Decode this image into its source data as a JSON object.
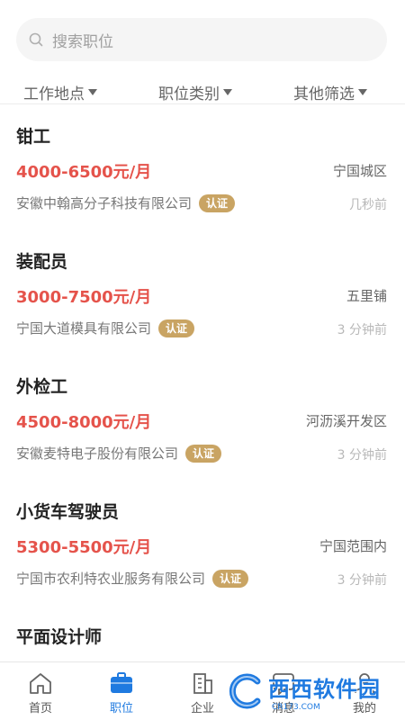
{
  "search": {
    "placeholder": "搜索职位"
  },
  "filters": [
    {
      "label": "工作地点"
    },
    {
      "label": "职位类别"
    },
    {
      "label": "其他筛选"
    }
  ],
  "jobs": [
    {
      "title": "钳工",
      "salary": "4000-6500元/月",
      "location": "宁国城区",
      "company": "安徽中翰高分子科技有限公司",
      "badge": "认证",
      "time": "几秒前"
    },
    {
      "title": "装配员",
      "salary": "3000-7500元/月",
      "location": "五里铺",
      "company": "宁国大道模具有限公司",
      "badge": "认证",
      "time": "3 分钟前"
    },
    {
      "title": "外检工",
      "salary": "4500-8000元/月",
      "location": "河沥溪开发区",
      "company": "安徽麦特电子股份有限公司",
      "badge": "认证",
      "time": "3 分钟前"
    },
    {
      "title": "小货车驾驶员",
      "salary": "5300-5500元/月",
      "location": "宁国范围内",
      "company": "宁国市农利特农业服务有限公司",
      "badge": "认证",
      "time": "3 分钟前"
    },
    {
      "title": "平面设计师",
      "salary": "",
      "location": "",
      "company": "",
      "badge": "",
      "time": ""
    }
  ],
  "nav": [
    {
      "label": "首页",
      "icon": "home-icon"
    },
    {
      "label": "职位",
      "icon": "briefcase-icon",
      "active": true
    },
    {
      "label": "企业",
      "icon": "building-icon"
    },
    {
      "label": "消息",
      "icon": "message-icon"
    },
    {
      "label": "我的",
      "icon": "user-icon"
    }
  ],
  "watermark": {
    "text": "西西软件园",
    "sub": "CR173.COM"
  },
  "colors": {
    "accent": "#1f7ae0",
    "salary": "#e5534b",
    "badge": "#c9a463"
  }
}
